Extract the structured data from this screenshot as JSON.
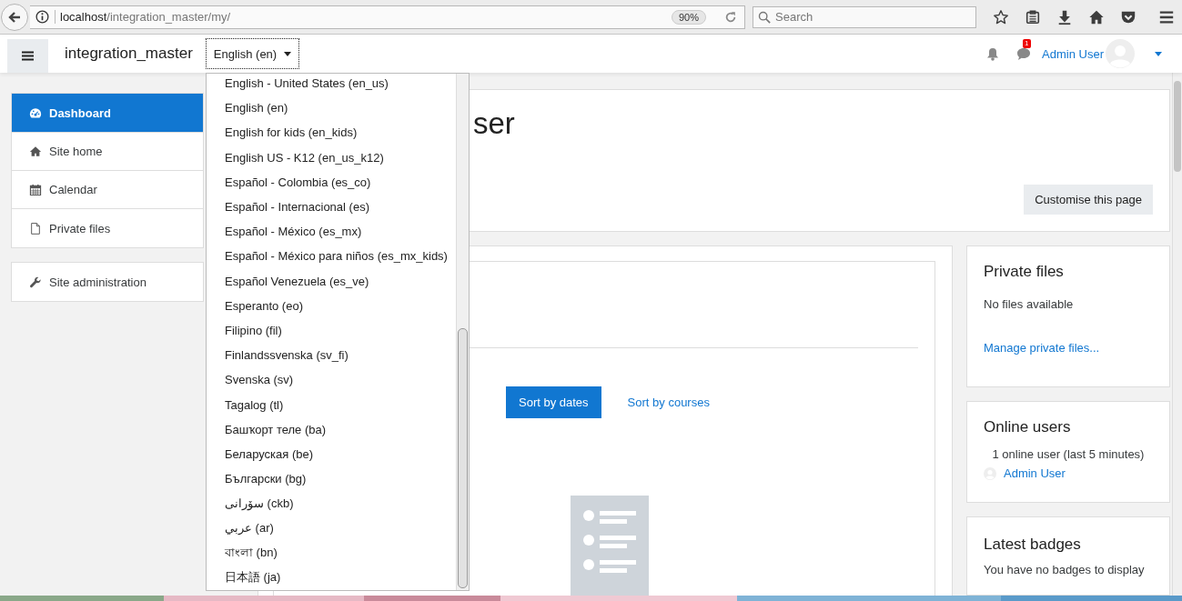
{
  "browser": {
    "url_host": "localhost",
    "url_path": "/integration_master/my/",
    "zoom": "90%",
    "search_placeholder": "Search"
  },
  "navbar": {
    "site_name": "integration_master",
    "language": "English (en)",
    "message_count": "1",
    "user_name": "Admin User"
  },
  "sidebar": {
    "items": [
      {
        "label": "Dashboard",
        "kind": "dashboard",
        "selected": true
      },
      {
        "label": "Site home",
        "kind": "home",
        "selected": false
      },
      {
        "label": "Calendar",
        "kind": "calendar",
        "selected": false
      },
      {
        "label": "Private files",
        "kind": "file",
        "selected": false
      }
    ],
    "admin_items": [
      {
        "label": "Site administration",
        "kind": "wrench",
        "selected": false
      }
    ]
  },
  "language_menu": {
    "items": [
      "English - United States (en_us)",
      "English (en)",
      "English for kids (en_kids)",
      "English US - K12 (en_us_k12)",
      "Español - Colombia (es_co)",
      "Español - Internacional (es)",
      "Español - México (es_mx)",
      "Español - México para niños (es_mx_kids)",
      "Español Venezuela (es_ve)",
      "Esperanto (eo)",
      "Filipino (fil)",
      "Finlandssvenska (sv_fi)",
      "Svenska (sv)",
      "Tagalog (tl)",
      "Башҡорт теле (ba)",
      "Беларуская (be)",
      "Български (bg)",
      "سۆرانی (ckb)",
      "عربي (ar)",
      "বাংলা (bn)",
      "日本語 (ja)"
    ]
  },
  "page_header": {
    "title": "ser",
    "button": "Customise this page"
  },
  "timeline": {
    "sort_options": [
      {
        "label": "Sort by dates",
        "selected": true
      },
      {
        "label": "Sort by courses",
        "selected": false
      }
    ]
  },
  "blocks": [
    {
      "kind": "files",
      "title": "Private files",
      "text": "No files available",
      "link": "Manage private files..."
    },
    {
      "kind": "online",
      "title": "Online users",
      "text": "1 online user (last 5 minutes)",
      "users": [
        "Admin User"
      ]
    },
    {
      "kind": "badges",
      "title": "Latest badges",
      "text": "You have no badges to display"
    }
  ]
}
